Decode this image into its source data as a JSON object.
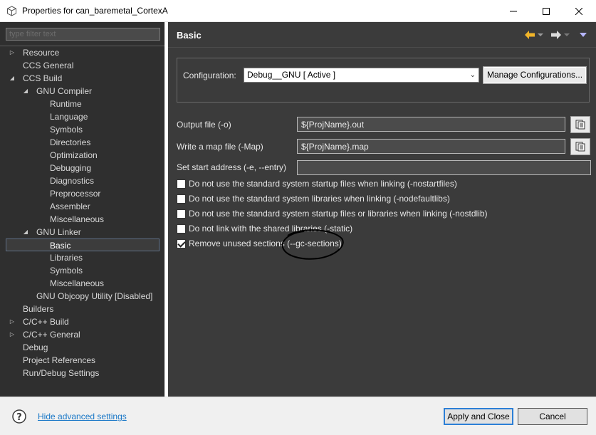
{
  "window": {
    "title": "Properties for can_baremetal_CortexA",
    "minimize_icon": "minimize-icon",
    "maximize_icon": "maximize-icon",
    "close_icon": "close-icon"
  },
  "sidebar": {
    "filter_placeholder": "type filter text",
    "items": [
      {
        "label": "Resource",
        "indent": 0,
        "arrow": "collapsed"
      },
      {
        "label": "CCS General",
        "indent": 0,
        "arrow": "none"
      },
      {
        "label": "CCS Build",
        "indent": 0,
        "arrow": "expanded"
      },
      {
        "label": "GNU Compiler",
        "indent": 1,
        "arrow": "expanded"
      },
      {
        "label": "Runtime",
        "indent": 2,
        "arrow": "none"
      },
      {
        "label": "Language",
        "indent": 2,
        "arrow": "none"
      },
      {
        "label": "Symbols",
        "indent": 2,
        "arrow": "none"
      },
      {
        "label": "Directories",
        "indent": 2,
        "arrow": "none"
      },
      {
        "label": "Optimization",
        "indent": 2,
        "arrow": "none"
      },
      {
        "label": "Debugging",
        "indent": 2,
        "arrow": "none"
      },
      {
        "label": "Diagnostics",
        "indent": 2,
        "arrow": "none"
      },
      {
        "label": "Preprocessor",
        "indent": 2,
        "arrow": "none"
      },
      {
        "label": "Assembler",
        "indent": 2,
        "arrow": "none"
      },
      {
        "label": "Miscellaneous",
        "indent": 2,
        "arrow": "none"
      },
      {
        "label": "GNU Linker",
        "indent": 1,
        "arrow": "expanded"
      },
      {
        "label": "Basic",
        "indent": 2,
        "arrow": "none",
        "selected": true
      },
      {
        "label": "Libraries",
        "indent": 2,
        "arrow": "none"
      },
      {
        "label": "Symbols",
        "indent": 2,
        "arrow": "none"
      },
      {
        "label": "Miscellaneous",
        "indent": 2,
        "arrow": "none"
      },
      {
        "label": "GNU Objcopy Utility  [Disabled]",
        "indent": 1,
        "arrow": "none"
      },
      {
        "label": "Builders",
        "indent": 0,
        "arrow": "none"
      },
      {
        "label": "C/C++ Build",
        "indent": 0,
        "arrow": "collapsed"
      },
      {
        "label": "C/C++ General",
        "indent": 0,
        "arrow": "collapsed"
      },
      {
        "label": "Debug",
        "indent": 0,
        "arrow": "none"
      },
      {
        "label": "Project References",
        "indent": 0,
        "arrow": "none"
      },
      {
        "label": "Run/Debug Settings",
        "indent": 0,
        "arrow": "none"
      }
    ]
  },
  "main": {
    "title": "Basic",
    "config_label": "Configuration:",
    "config_value": "Debug__GNU  [ Active ]",
    "manage_label": "Manage Configurations...",
    "output_label": "Output file (-o)",
    "output_value": "${ProjName}.out",
    "map_label": "Write a map file (-Map)",
    "map_value": "${ProjName}.map",
    "start_label": "Set start address (-e, --entry)",
    "start_value": "",
    "checks": [
      {
        "label": "Do not use the standard system startup files when linking (-nostartfiles)",
        "checked": false
      },
      {
        "label": "Do not use the standard system libraries when linking (-nodefaultlibs)",
        "checked": false
      },
      {
        "label": "Do not use the standard system startup files or libraries when linking (-nostdlib)",
        "checked": false
      },
      {
        "label": "Do not link with the shared libraries (-static)",
        "checked": false
      },
      {
        "label": "Remove unused sections (--gc-sections)",
        "checked": true
      }
    ]
  },
  "footer": {
    "advanced_link": "Hide advanced settings",
    "apply_label": "Apply and Close",
    "cancel_label": "Cancel"
  },
  "colors": {
    "panel_bg": "#3b3b3b",
    "tree_bg": "#2f2f2f",
    "link": "#1a78c7",
    "back_arrow": "#f0b429"
  }
}
